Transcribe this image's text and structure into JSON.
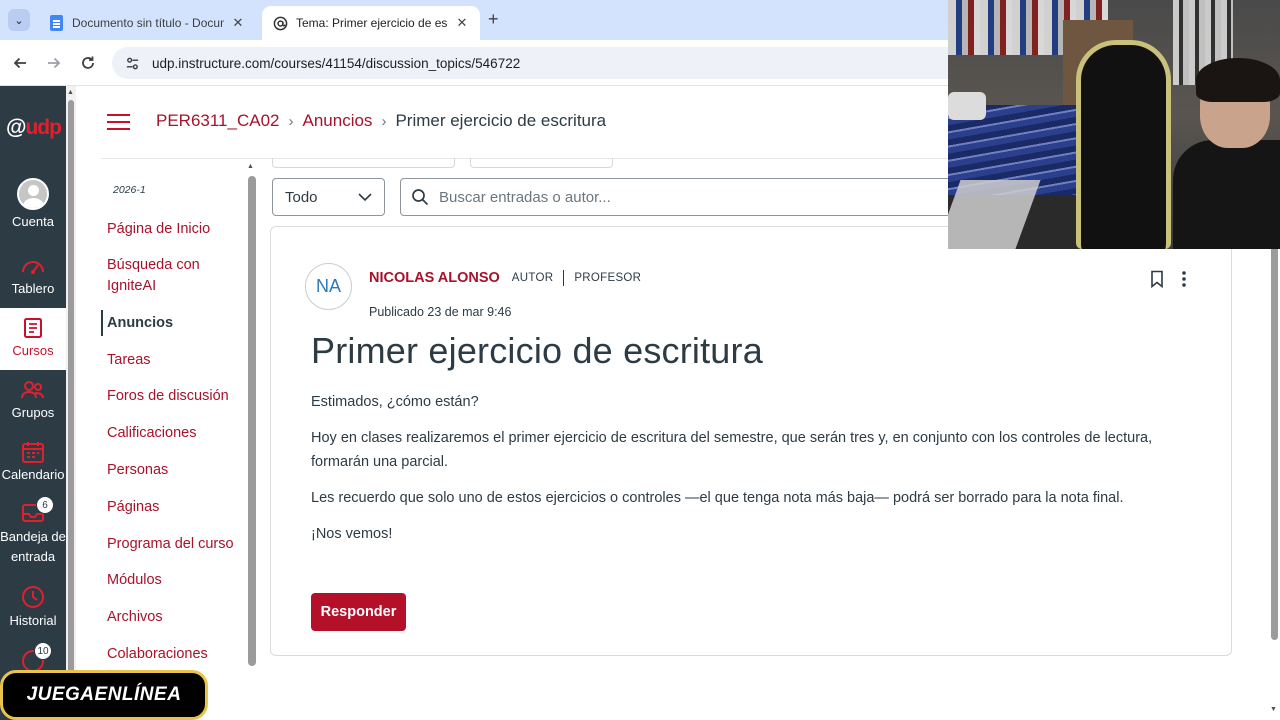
{
  "browser": {
    "tabs": [
      {
        "title": "Documento sin título - Docume",
        "active": false
      },
      {
        "title": "Tema: Primer ejercicio de escrit",
        "active": true
      }
    ],
    "url": "udp.instructure.com/courses/41154/discussion_topics/546722"
  },
  "global_nav": {
    "logo": "@udp",
    "items": [
      {
        "label": "Cuenta",
        "icon": "account-avatar"
      },
      {
        "label": "Tablero",
        "icon": "dashboard-gauge-icon"
      },
      {
        "label": "Cursos",
        "icon": "courses-book-icon"
      },
      {
        "label": "Grupos",
        "icon": "groups-people-icon"
      },
      {
        "label": "Calendario",
        "icon": "calendar-icon"
      },
      {
        "label_line1": "Bandeja de",
        "label_line2": "entrada",
        "icon": "inbox-icon",
        "badge": "6"
      },
      {
        "label": "Historial",
        "icon": "history-clock-icon"
      },
      {
        "icon": "help-icon",
        "badge": "10"
      }
    ]
  },
  "breadcrumb": {
    "course": "PER6311_CA02",
    "section": "Anuncios",
    "current": "Primer ejercicio de escritura"
  },
  "course_nav": {
    "term": "2026-1",
    "items": [
      "Página de Inicio",
      "Búsqueda con IgniteAI",
      "Anuncios",
      "Tareas",
      "Foros de discusión",
      "Calificaciones",
      "Personas",
      "Páginas",
      "Programa del curso",
      "Módulos",
      "Archivos",
      "Colaboraciones"
    ],
    "active_item": "Anuncios"
  },
  "filters": {
    "select_value": "Todo",
    "search_placeholder": "Buscar entradas o autor..."
  },
  "post": {
    "avatar_initials": "NA",
    "author": "NICOLAS ALONSO",
    "role1": "AUTOR",
    "role2": "PROFESOR",
    "published": "Publicado 23 de mar 9:46",
    "title": "Primer ejercicio de escritura",
    "paragraphs": [
      "Estimados, ¿cómo están?",
      "Hoy en clases realizaremos el primer ejercicio de escritura del semestre, que serán tres y, en conjunto con los controles de lectura, formarán una parcial.",
      "Les recuerdo que solo uno de estos ejercicios o controles —el que tenga nota más baja— podrá ser borrado para la nota final.",
      "¡Nos vemos!"
    ],
    "reply_label": "Responder"
  },
  "watermark": "JUEGAENLÍNEA",
  "colors": {
    "brand_red": "#a8122a",
    "button_red": "#b5102a",
    "nav_dark": "#2d3b45",
    "tabstrip": "#d3e3fd"
  }
}
